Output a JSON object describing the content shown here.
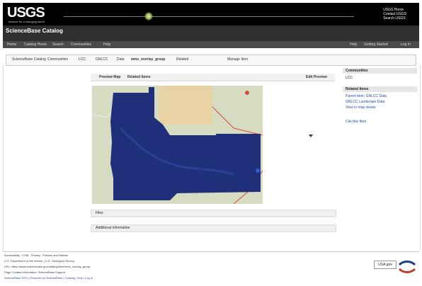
{
  "header": {
    "logo_text": "USGS",
    "logo_subtext": "science for a changing world",
    "top_links": [
      "USGS Home",
      "Contact USGS",
      "Search USGS"
    ]
  },
  "site": {
    "title": "ScienceBase Catalog",
    "nav_left": [
      "Home",
      "Catalog Home",
      "Search",
      "Communities",
      "Help"
    ],
    "nav_right": [
      "Help",
      "Getting Started",
      "Log In"
    ]
  },
  "breadcrumb": [
    "ScienceBase Catalog",
    "Communities",
    "LCC",
    "GNLCC",
    "Data",
    "wms_overlay_group",
    "Related",
    "Manage Item"
  ],
  "panel": {
    "header_left": "Preview Map",
    "header_mid": "Related Items",
    "header_right": "Edit Preview"
  },
  "sections": {
    "files": "Files",
    "metadata": "Additional Information"
  },
  "sidebar": {
    "communities_title": "Communities",
    "communities_value": "LCC",
    "related_title": "Related Items",
    "links": [
      "Parent Item: GNLCC Data",
      "GNLCC Landscape Data",
      "View in map viewer"
    ],
    "citation": "Cite this Item"
  },
  "footer": {
    "links": [
      "Accessibility",
      "FOIA",
      "Privacy",
      "Policies and Notices"
    ],
    "lines": [
      "U.S. Department of the Interior | U.S. Geological Survey",
      "URL: https://www.sciencebase.gov/catalog/item/wms_overlay_group",
      "Page Contact Information: ScienceBase Support",
      "ScienceBase 2013 | Powered by ScienceBase | Catalog | Help | Log In"
    ],
    "badge": "USA.gov"
  },
  "colors": {
    "header_bg": "#000000",
    "subheader_bg": "#2f2f2f",
    "map_overlay": "#1f2f7a",
    "map_base": "#d3dbbd"
  }
}
